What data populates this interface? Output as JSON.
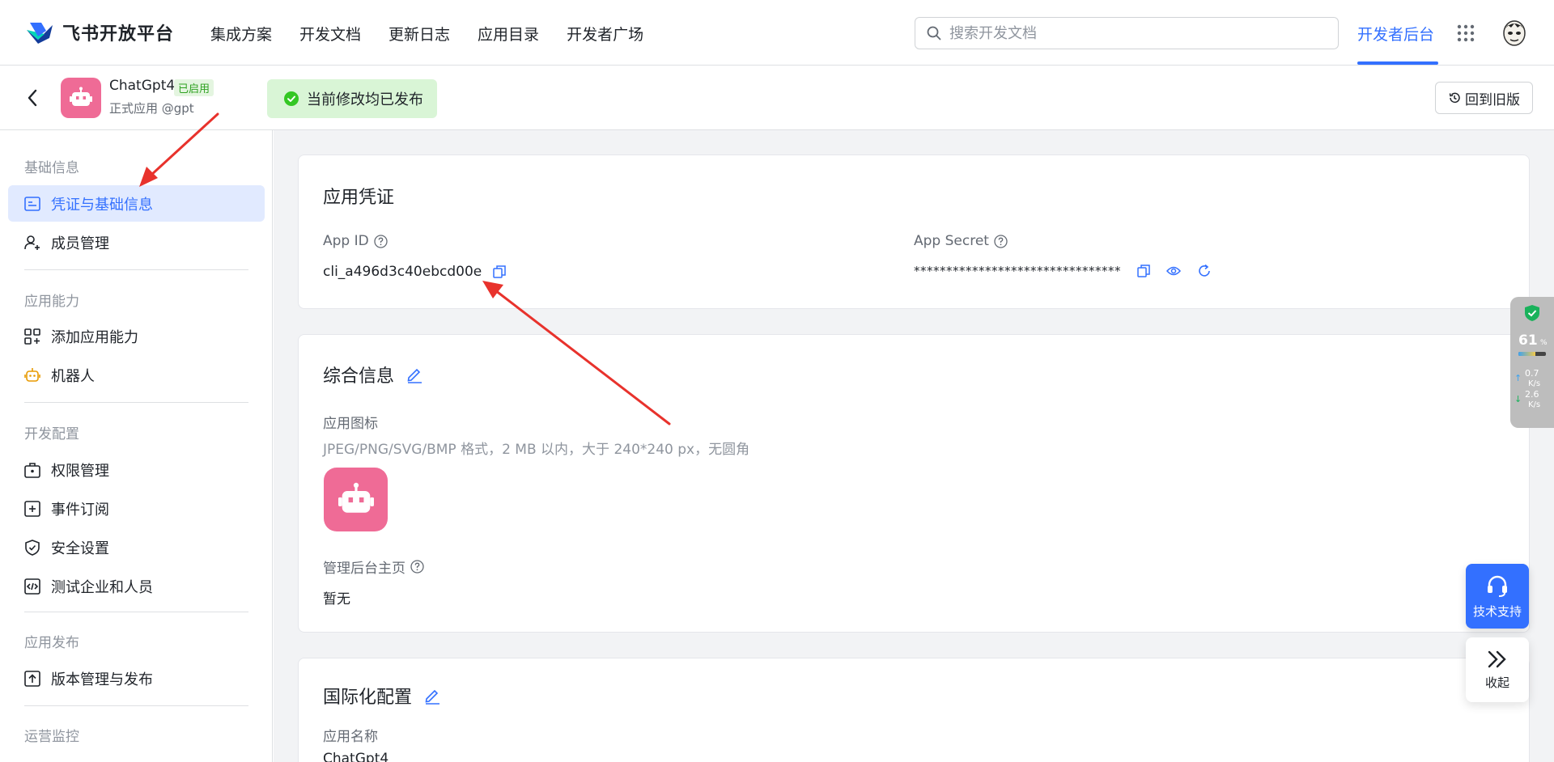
{
  "topnav": {
    "brand": "飞书开放平台",
    "links": [
      "集成方案",
      "开发文档",
      "更新日志",
      "应用目录",
      "开发者广场"
    ],
    "search_placeholder": "搜索开发文档",
    "console": "开发者后台"
  },
  "app": {
    "name": "ChatGpt4",
    "badge": "已启用",
    "sub": "正式应用 @gpt",
    "status": "当前修改均已发布",
    "old_version": "回到旧版"
  },
  "sidebar": {
    "groups": [
      {
        "title": "基础信息",
        "items": [
          "凭证与基础信息",
          "成员管理"
        ]
      },
      {
        "title": "应用能力",
        "items": [
          "添加应用能力",
          "机器人"
        ]
      },
      {
        "title": "开发配置",
        "items": [
          "权限管理",
          "事件订阅",
          "安全设置",
          "测试企业和人员"
        ]
      },
      {
        "title": "应用发布",
        "items": [
          "版本管理与发布"
        ]
      },
      {
        "title": "运营监控",
        "items": []
      }
    ]
  },
  "credentials": {
    "title": "应用凭证",
    "app_id_label": "App ID",
    "app_id": "cli_a496d3c40ebcd00e",
    "secret_label": "App Secret",
    "secret": "********************************"
  },
  "general": {
    "title": "综合信息",
    "icon_label": "应用图标",
    "icon_hint": "JPEG/PNG/SVG/BMP 格式，2 MB 以内，大于 240*240 px，无圆角",
    "home_label": "管理后台主页",
    "home_value": "暂无"
  },
  "i18n": {
    "title": "国际化配置",
    "name_label": "应用名称",
    "name_value": "ChatGpt4"
  },
  "netmon": {
    "percent": "61",
    "percent_sign": "%",
    "usage_fraction": 0.61,
    "up": "0.7",
    "down": "2.6",
    "unit": "K/s"
  },
  "widgets": {
    "support": "技术支持",
    "collapse": "收起"
  },
  "colors": {
    "accent": "#3370ff",
    "app_icon": "#ef6b96",
    "status_bg": "#d9f5d6",
    "annotation": "#e8322c"
  }
}
